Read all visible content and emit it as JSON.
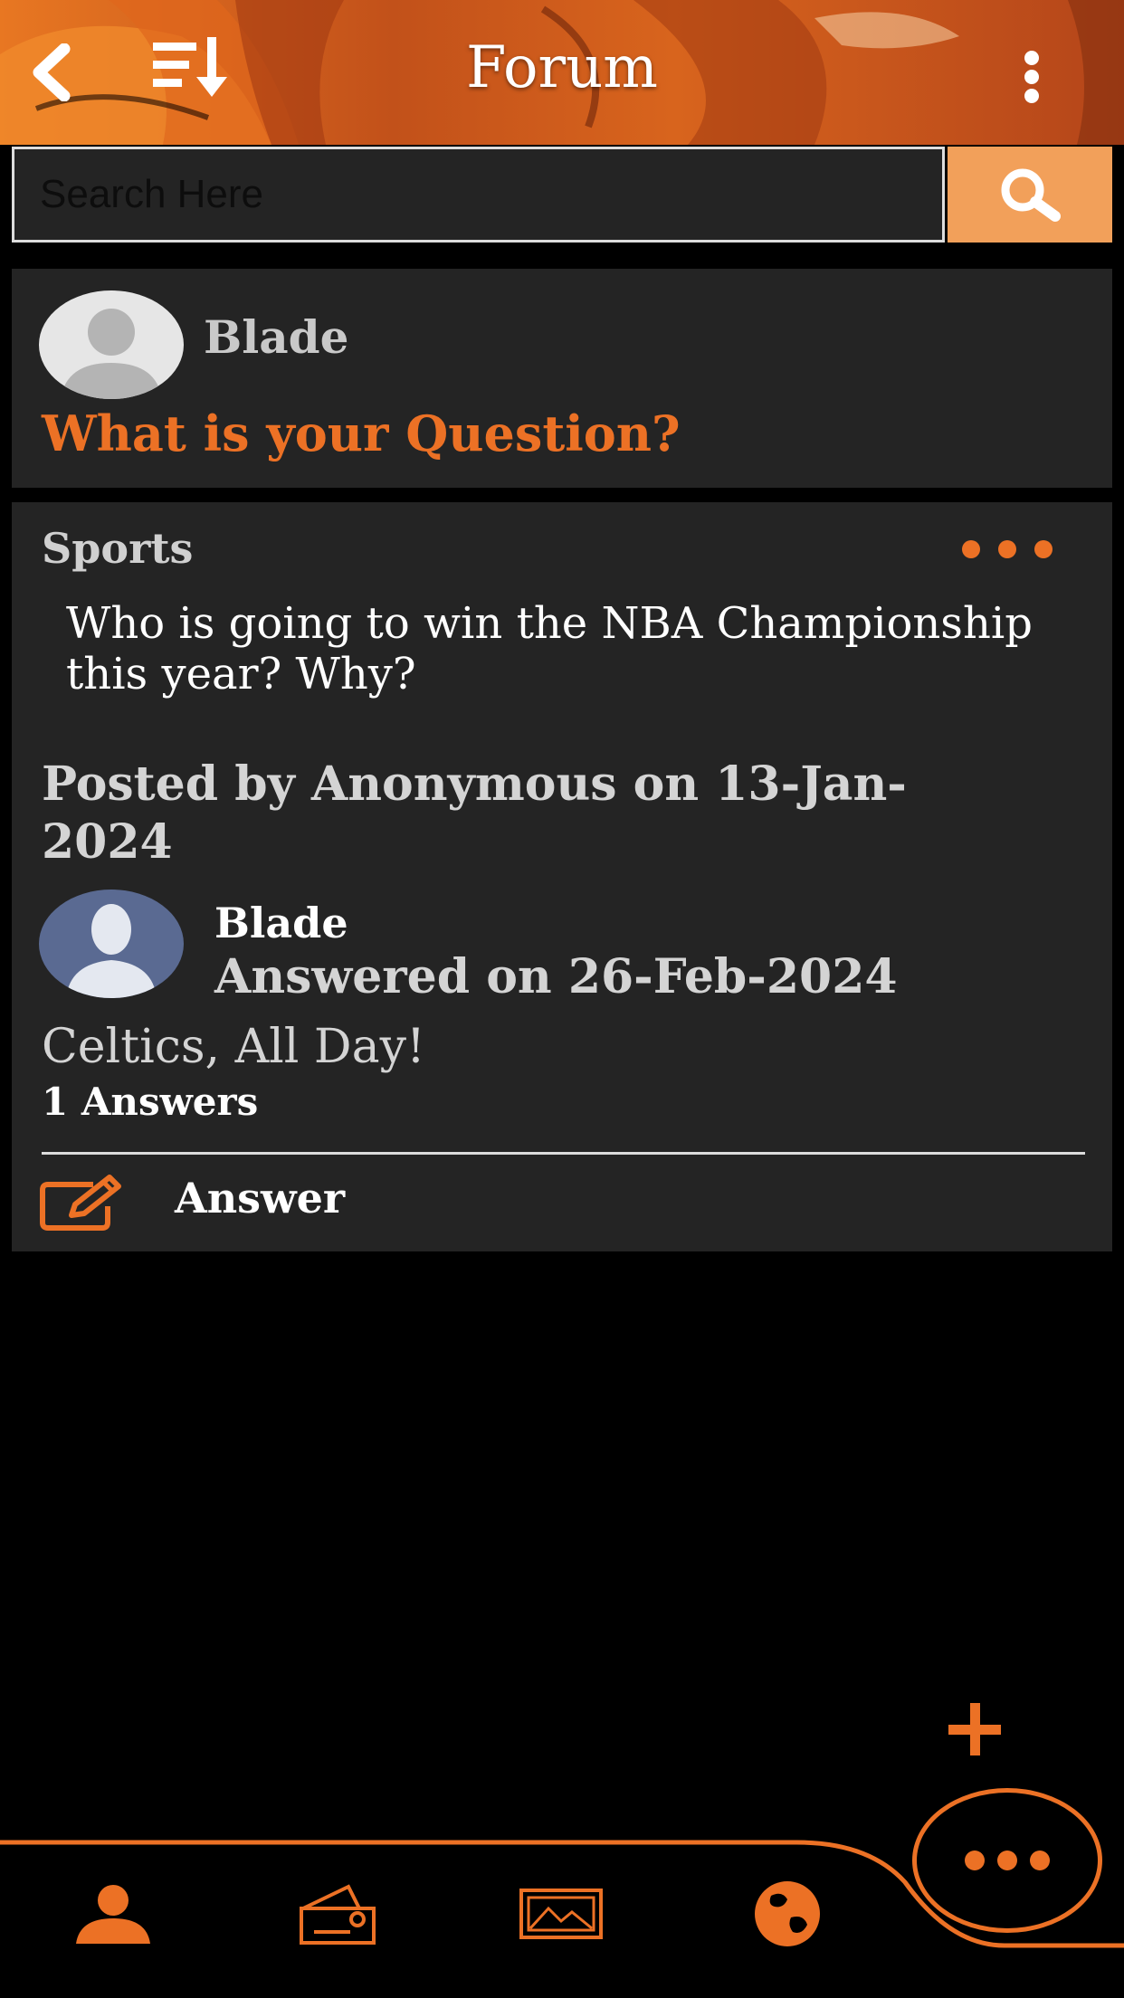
{
  "header": {
    "title": "Forum",
    "icons": {
      "back": "chevron-left-icon",
      "sort": "sort-icon",
      "menu": "vertical-ellipsis-icon"
    }
  },
  "search": {
    "placeholder": "Search Here",
    "value": "",
    "icon": "search-icon"
  },
  "ask": {
    "user_name": "Blade",
    "prompt": "What is your Question?"
  },
  "post": {
    "category": "Sports",
    "question": "Who is going to win the NBA Championship this year? Why?",
    "posted_by": "Posted by Anonymous on 13-Jan-2024",
    "answer": {
      "user_name": "Blade",
      "answered_on": "Answered on 26-Feb-2024",
      "text": "Celtics,  All Day!"
    },
    "answer_count": "1 Answers",
    "answer_button_label": "Answer"
  },
  "bottom_nav": {
    "items": [
      "profile-icon",
      "money-icon",
      "gallery-icon",
      "globe-icon"
    ],
    "fab_icon": "more-horizontal-icon",
    "add_icon": "plus-icon"
  },
  "colors": {
    "accent": "#ec7125",
    "card": "#242424",
    "search_button": "#f2a05a",
    "background": "#000000"
  }
}
